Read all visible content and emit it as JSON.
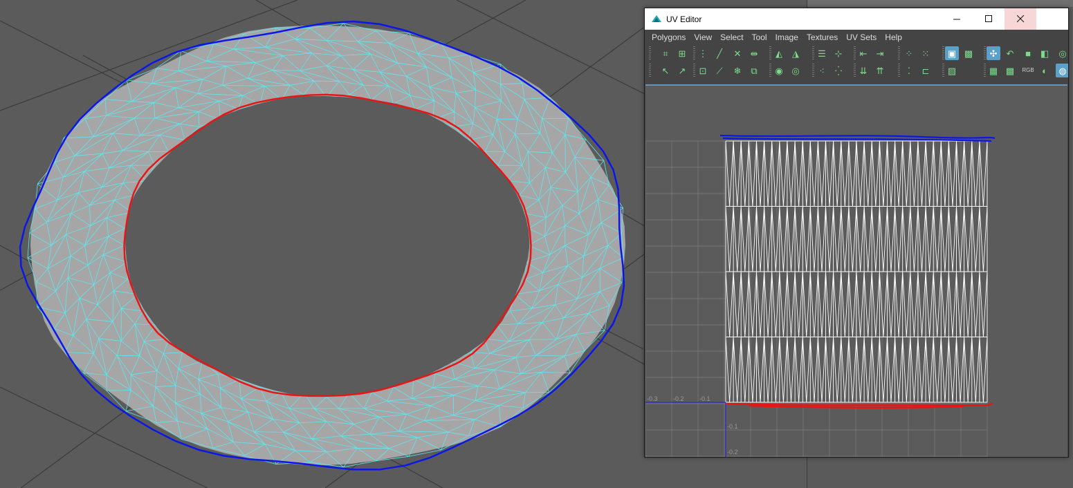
{
  "viewport": {
    "colors": {
      "background": "#5b5b5b",
      "mesh_fill": "#a6a6a6",
      "wireframe": "#5fe6ef",
      "outer_stroke": "#0b17e8",
      "inner_stroke": "#e71515",
      "grid_line": "#3a3a3a"
    }
  },
  "uv_editor": {
    "title": "UV Editor",
    "window_buttons": {
      "minimize": "—",
      "maximize": "☐",
      "close": "✕"
    },
    "menus": [
      "Polygons",
      "View",
      "Select",
      "Tool",
      "Image",
      "Textures",
      "UV Sets",
      "Help"
    ],
    "toolbar_icons_row1": [
      "uv-grid-icon",
      "uv-snap-icon",
      "cut-uv-icon",
      "sew-uv-icon",
      "delete-edge-icon",
      "split-uv-icon",
      "flip-u-icon",
      "flip-v-icon",
      "align-icon",
      "distribute-icon",
      "move-left-icon",
      "move-right-icon",
      "select-shell-icon",
      "select-border-icon",
      "image-display-icon",
      "checker-icon",
      "uv-grid-snap-icon",
      "rotate-uv-icon",
      "color-icon",
      "mask-icon",
      "shading-icon"
    ],
    "toolbar_icons_row2": [
      "select-arrow-icon",
      "lasso-icon",
      "unfold-icon",
      "symmetrize-icon",
      "freeze-icon",
      "stack-icon",
      "rotate-cw-icon",
      "rotate-ccw-icon",
      "layout-icon",
      "normalize-icon",
      "move-down-icon",
      "move-up-icon",
      "uv-pin-icon",
      "uv-unpin-icon",
      "dim-image-icon",
      "grid-icon",
      "pattern-icon",
      "rgb-icon",
      "shaded-sphere-icon",
      "texture-border-icon"
    ],
    "rgb_label": "RGB",
    "axis_ticks_u": [
      "-0.3",
      "-0.2",
      "-0.1"
    ],
    "axis_ticks_v": [
      "-0.1",
      "-0.2"
    ],
    "colors": {
      "canvas_bg": "#5b5b5b",
      "grid": "#7c7c7c",
      "uv_wire": "#ffffff",
      "axis": "#2a2ad8",
      "top_edge_stroke": "#0b17e8",
      "bottom_edge_stroke": "#e71515"
    }
  }
}
